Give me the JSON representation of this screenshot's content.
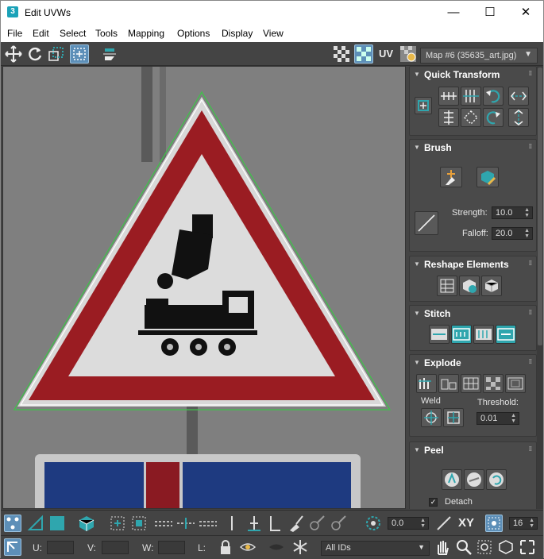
{
  "window": {
    "icon_label": "3",
    "title": "Edit UVWs",
    "minimize_glyph": "—",
    "maximize_glyph": "☐",
    "close_glyph": "✕"
  },
  "menubar": [
    "File",
    "Edit",
    "Select",
    "Tools",
    "Mapping",
    "Options",
    "Display",
    "View"
  ],
  "toolbar": {
    "uv_label": "UV",
    "map_select": "Map #6 (35635_art.jpg)",
    "dropdown_glyph": "▼",
    "icons": [
      "move-icon",
      "rotate-icon",
      "scale-icon",
      "freeform-icon",
      "mirror-icon",
      "checker-icon",
      "checker-grid-icon",
      "uv-label-icon",
      "texture-settings-icon"
    ]
  },
  "panel": {
    "quick_transform": {
      "title": "Quick Transform"
    },
    "brush": {
      "title": "Brush",
      "strength_label": "Strength:",
      "strength": "10.0",
      "falloff_label": "Falloff:",
      "falloff": "20.0"
    },
    "reshape": {
      "title": "Reshape Elements"
    },
    "stitch": {
      "title": "Stitch"
    },
    "explode": {
      "title": "Explode",
      "weld_label": "Weld",
      "threshold_label": "Threshold:",
      "threshold": "0.01"
    },
    "peel": {
      "title": "Peel",
      "detach_label": "Detach",
      "detach_checked": true
    }
  },
  "bottom_bar": {
    "angle_value": "0.0",
    "xy_label": "XY",
    "pixel_value": "16",
    "u_label": "U:",
    "v_label": "V:",
    "w_label": "W:",
    "l_label": "L:",
    "ids_select": "All IDs"
  },
  "colors": {
    "accent_teal": "#2fa6ae",
    "sign_red": "#9a1c22",
    "sign_white": "#dcdcdc",
    "sign_blue": "#1e3a80",
    "uv_edge_green": "#3fc24a",
    "active_blue": "#5d8fb8"
  }
}
